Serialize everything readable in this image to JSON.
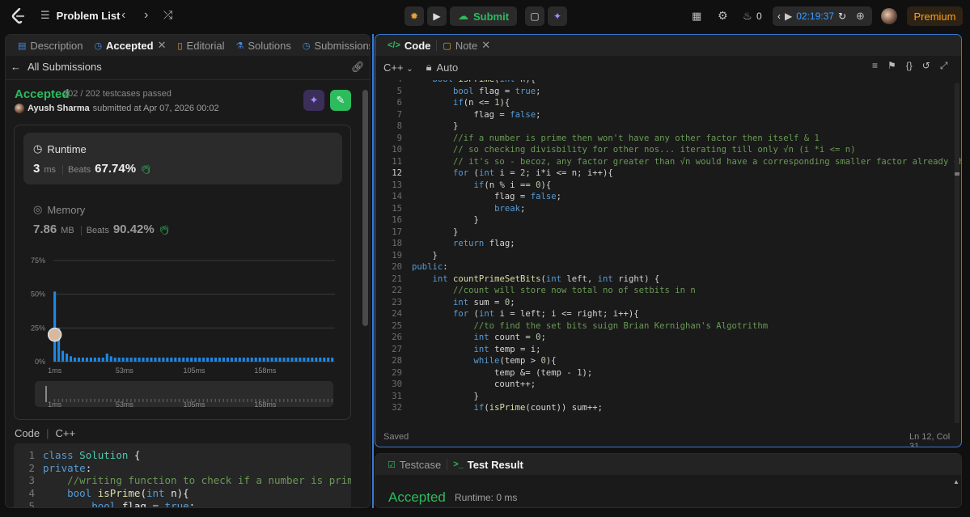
{
  "topbar": {
    "problem_list": "Problem List",
    "submit": "Submit",
    "fire_count": "0",
    "timer": "02:19:37",
    "premium": "Premium"
  },
  "left_tabs": [
    "Description",
    "Accepted",
    "Editorial",
    "Solutions",
    "Submissions"
  ],
  "submission": {
    "back_label": "All Submissions",
    "status": "Accepted",
    "testcases": "202 / 202 testcases passed",
    "user": "Ayush Sharma",
    "submitted": "submitted at Apr 07, 2026 00:02",
    "runtime_label": "Runtime",
    "runtime_value": "3",
    "runtime_unit": "ms",
    "runtime_beats_label": "Beats",
    "runtime_beats": "67.74%",
    "memory_label": "Memory",
    "memory_value": "7.86",
    "memory_unit": "MB",
    "memory_beats_label": "Beats",
    "memory_beats": "90.42%"
  },
  "chart_data": {
    "type": "bar",
    "ytick_labels": [
      "75%",
      "50%",
      "25%",
      "0%"
    ],
    "yticks": [
      75,
      50,
      25,
      0
    ],
    "ylim": [
      0,
      80
    ],
    "xtick_labels": [
      "1ms",
      "53ms",
      "105ms",
      "158ms"
    ],
    "xlim": [
      0,
      210
    ],
    "bar_x": [
      1,
      4,
      7,
      10,
      13,
      16,
      19,
      22,
      25,
      28,
      31,
      34,
      37,
      40,
      43,
      46,
      49,
      52,
      55,
      58,
      61,
      64,
      67,
      70,
      73,
      76,
      79,
      82,
      85,
      88,
      91,
      94,
      97,
      100,
      103,
      106,
      109,
      112,
      115,
      118,
      121,
      124,
      127,
      130,
      133,
      136,
      139,
      142,
      145,
      148,
      151,
      154,
      157,
      160,
      163,
      166,
      169,
      172,
      175,
      178,
      181,
      184,
      187,
      190,
      193,
      196,
      199,
      202,
      205,
      208
    ],
    "bar_values": [
      52,
      25,
      8,
      6,
      4,
      3,
      3,
      3,
      3,
      3,
      3,
      3,
      3,
      6,
      4,
      3,
      3,
      3,
      3,
      3,
      3,
      3,
      3,
      3,
      3,
      3,
      3,
      3,
      3,
      3,
      3,
      3,
      3,
      3,
      3,
      3,
      3,
      3,
      3,
      3,
      3,
      3,
      3,
      3,
      3,
      3,
      3,
      3,
      3,
      3,
      3,
      3,
      3,
      3,
      3,
      3,
      3,
      3,
      3,
      3,
      3,
      3,
      3,
      3,
      3,
      3,
      3,
      3,
      3,
      3
    ],
    "marker": {
      "x": 1,
      "y": 20
    },
    "grid": true
  },
  "left_code": {
    "label": "Code",
    "lang": "C++",
    "lines": [
      "class Solution {",
      "private:",
      "    //writing function to check if a number is prime or n",
      "    bool isPrime(int n){",
      "        bool flag = true;"
    ]
  },
  "code_panel": {
    "tab_code": "Code",
    "tab_note": "Note",
    "lang": "C++",
    "mode": "Auto",
    "status": "Saved",
    "cursor": "Ln 12, Col 31",
    "start_line": 4,
    "current_line": 12,
    "lines": [
      "    bool isPrime(int n){",
      "        bool flag = true;",
      "        if(n <= 1){",
      "            flag = false;",
      "        }",
      "        //if a number is prime then won't have any other factor then itself & 1",
      "        // so checking divisbility for other nos... iterating till only √n (i *i <= n)",
      "        // it's so - becoz, any factor greater than √n would have a corresponding smaller factor already checked...",
      "        for (int i = 2; i*i <= n; i++){",
      "            if(n % i == 0){",
      "                flag = false;",
      "                break;",
      "            }",
      "        }",
      "        return flag;",
      "    }",
      "public:",
      "    int countPrimeSetBits(int left, int right) {",
      "        //count will store now total no of setbits in n",
      "        int sum = 0;",
      "        for (int i = left; i <= right; i++){",
      "            //to find the set bits suign Brian Kernighan's Algotrithm",
      "            int count = 0;",
      "            int temp = i;",
      "            while(temp > 0){",
      "                temp &= (temp - 1);",
      "                count++;",
      "            }",
      "            if(isPrime(count)) sum++;"
    ]
  },
  "test_panel": {
    "tab_testcase": "Testcase",
    "tab_result": "Test Result",
    "status": "Accepted",
    "runtime": "Runtime: 0 ms"
  },
  "colors": {
    "accent_green": "#2cbb5d",
    "blue": "#3b9cff",
    "premium": "#ffa116"
  }
}
